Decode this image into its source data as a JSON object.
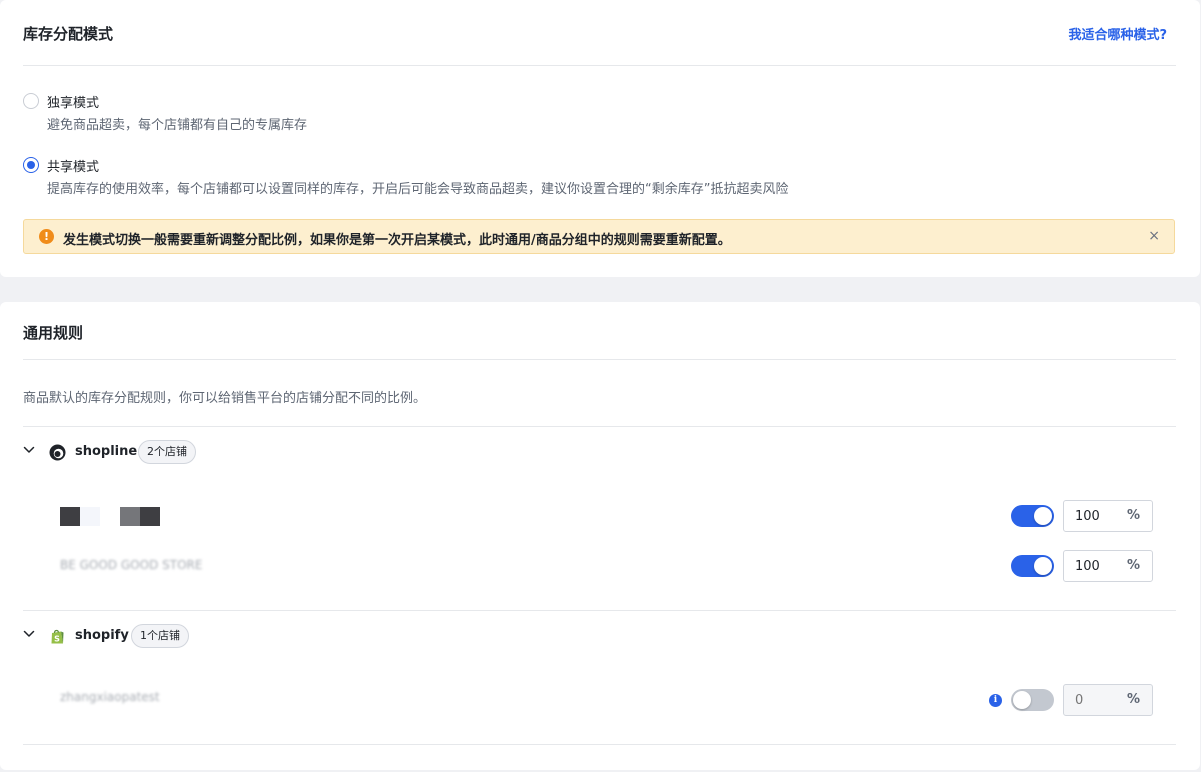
{
  "mode_section": {
    "title": "库存分配模式",
    "help_link": "我适合哪种模式?",
    "options": [
      {
        "label": "独享模式",
        "description": "避免商品超卖，每个店铺都有自己的专属库存",
        "selected": false
      },
      {
        "label": "共享模式",
        "description": "提高库存的使用效率，每个店铺都可以设置同样的库存，开启后可能会导致商品超卖，建议你设置合理的“剩余库存”抵抗超卖风险",
        "selected": true
      }
    ],
    "alert": {
      "icon": "warning-icon",
      "icon_glyph": "!",
      "text": "发生模式切换一般需要重新调整分配比例，如果你是第一次开启某模式，此时通用/商品分组中的规则需要重新配置。",
      "close_glyph": "×",
      "background_color": "#fdefcf"
    }
  },
  "rules_section": {
    "title": "通用规则",
    "description": "商品默认的库存分配规则，你可以给销售平台的店铺分配不同的比例。",
    "groups": [
      {
        "platform": "shopline",
        "store_count": "2个店铺",
        "icon": "shopline-logo-icon",
        "stores": [
          {
            "name": "",
            "enabled": true,
            "percent": "100",
            "unit": "%"
          },
          {
            "name": "BE GOOD GOOD STORE",
            "enabled": true,
            "percent": "100",
            "unit": "%"
          }
        ]
      },
      {
        "platform": "shopify",
        "store_count": "1个店铺",
        "icon": "shopify-logo-icon",
        "stores": [
          {
            "name": "zhangxiaopatest",
            "enabled": false,
            "percent": "",
            "placeholder": "0",
            "unit": "%",
            "info_glyph": "i"
          }
        ]
      }
    ]
  },
  "colors": {
    "accent": "#2a62e8",
    "warning": "#f08c1a",
    "page_background": "#f0f1f4"
  }
}
